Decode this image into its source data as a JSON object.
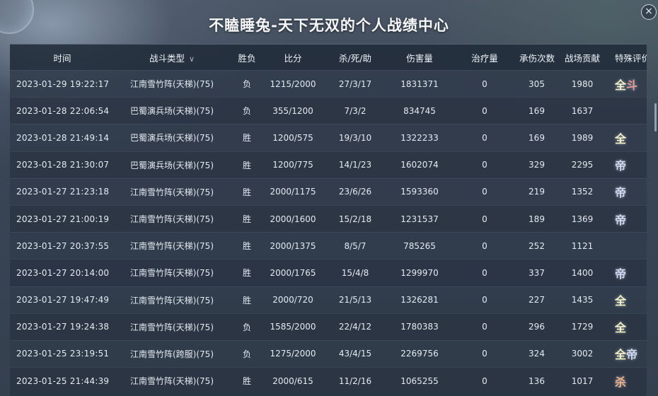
{
  "window": {
    "title": "不瞌睡兔-天下无双的个人战绩中心",
    "close_label": "×"
  },
  "table": {
    "headers": {
      "time": "时间",
      "type": "战斗类型",
      "result": "胜负",
      "score": "比分",
      "kda": "杀/死/助",
      "damage": "伤害量",
      "heal": "治疗量",
      "hits": "承伤次数",
      "contribution": "战场贡献",
      "evaluation": "特殊评价"
    },
    "rows": [
      {
        "time": "2023-01-29 19:22:17",
        "type": "江南雪竹阵(天梯)(75)",
        "result": "负",
        "score": "1215/2000",
        "kda": "27/3/17",
        "damage": "1831371",
        "heal": "0",
        "hits": "305",
        "contribution": "1980",
        "eval": [
          "全",
          "斗"
        ]
      },
      {
        "time": "2023-01-28 22:06:54",
        "type": "巴蜀演兵场(天梯)(75)",
        "result": "负",
        "score": "355/1200",
        "kda": "7/3/2",
        "damage": "834745",
        "heal": "0",
        "hits": "169",
        "contribution": "1637",
        "eval": []
      },
      {
        "time": "2023-01-28 21:49:14",
        "type": "巴蜀演兵场(天梯)(75)",
        "result": "胜",
        "score": "1200/575",
        "kda": "19/3/10",
        "damage": "1322233",
        "heal": "0",
        "hits": "169",
        "contribution": "1989",
        "eval": [
          "全"
        ]
      },
      {
        "time": "2023-01-28 21:30:07",
        "type": "巴蜀演兵场(天梯)(75)",
        "result": "胜",
        "score": "1200/775",
        "kda": "14/1/23",
        "damage": "1602074",
        "heal": "0",
        "hits": "329",
        "contribution": "2295",
        "eval": [
          "帝"
        ]
      },
      {
        "time": "2023-01-27 21:23:18",
        "type": "江南雪竹阵(天梯)(75)",
        "result": "胜",
        "score": "2000/1175",
        "kda": "23/6/26",
        "damage": "1593360",
        "heal": "0",
        "hits": "219",
        "contribution": "1352",
        "eval": [
          "帝"
        ]
      },
      {
        "time": "2023-01-27 21:00:19",
        "type": "江南雪竹阵(天梯)(75)",
        "result": "胜",
        "score": "2000/1600",
        "kda": "15/2/18",
        "damage": "1231537",
        "heal": "0",
        "hits": "189",
        "contribution": "1369",
        "eval": [
          "帝"
        ]
      },
      {
        "time": "2023-01-27 20:37:55",
        "type": "江南雪竹阵(天梯)(75)",
        "result": "胜",
        "score": "2000/1375",
        "kda": "8/5/7",
        "damage": "785265",
        "heal": "0",
        "hits": "252",
        "contribution": "1121",
        "eval": []
      },
      {
        "time": "2023-01-27 20:14:00",
        "type": "江南雪竹阵(天梯)(75)",
        "result": "胜",
        "score": "2000/1765",
        "kda": "15/4/8",
        "damage": "1299970",
        "heal": "0",
        "hits": "337",
        "contribution": "1400",
        "eval": [
          "帝"
        ]
      },
      {
        "time": "2023-01-27 19:47:49",
        "type": "江南雪竹阵(天梯)(75)",
        "result": "胜",
        "score": "2000/720",
        "kda": "21/5/13",
        "damage": "1326281",
        "heal": "0",
        "hits": "227",
        "contribution": "1435",
        "eval": [
          "全"
        ]
      },
      {
        "time": "2023-01-27 19:24:38",
        "type": "江南雪竹阵(天梯)(75)",
        "result": "负",
        "score": "1585/2000",
        "kda": "22/4/12",
        "damage": "1780383",
        "heal": "0",
        "hits": "296",
        "contribution": "1729",
        "eval": [
          "全"
        ]
      },
      {
        "time": "2023-01-25 23:19:51",
        "type": "江南雪竹阵(跨服)(75)",
        "result": "负",
        "score": "1275/2000",
        "kda": "43/4/15",
        "damage": "2269756",
        "heal": "0",
        "hits": "324",
        "contribution": "3002",
        "eval": [
          "全",
          "帝"
        ]
      },
      {
        "time": "2023-01-25 21:44:39",
        "type": "江南雪竹阵(天梯)(75)",
        "result": "胜",
        "score": "2000/615",
        "kda": "11/2/16",
        "damage": "1065255",
        "heal": "0",
        "hits": "136",
        "contribution": "1017",
        "eval": [
          "杀"
        ]
      }
    ]
  },
  "colors": {
    "quan": "#f3f1c8",
    "dou": "#e89a9a",
    "di": "#cfd9f4",
    "sha": "#eeb08a"
  },
  "icons": {
    "sort": "chevron-down-icon",
    "close": "close-icon"
  }
}
